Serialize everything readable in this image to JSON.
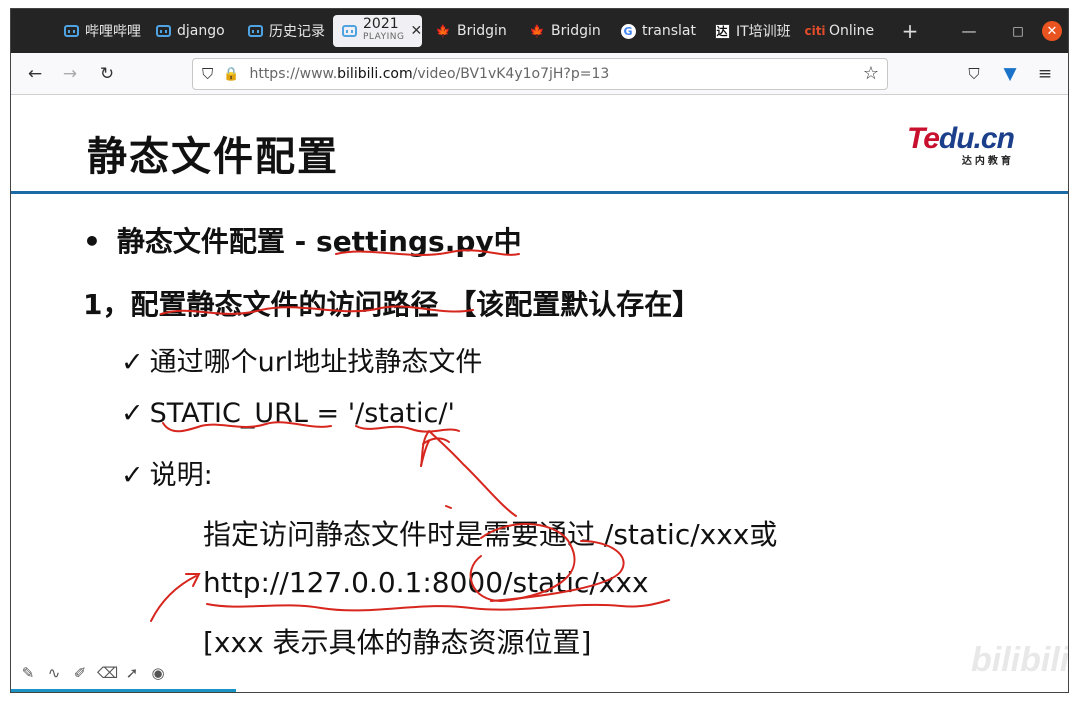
{
  "browser": {
    "tabs": [
      {
        "label": "哔哩哔哩",
        "icon": "bilibili-tv-icon"
      },
      {
        "label": "django",
        "icon": "bilibili-tv-icon"
      },
      {
        "label": "历史记录",
        "icon": "bilibili-tv-icon"
      },
      {
        "label": "2021",
        "sub": "PLAYING",
        "icon": "bilibili-tv-icon",
        "active": true
      },
      {
        "label": "Bridgin",
        "icon": "maple-leaf-icon"
      },
      {
        "label": "Bridgin",
        "icon": "maple-leaf-icon"
      },
      {
        "label": "translat",
        "icon": "google-icon"
      },
      {
        "label": "IT培训班",
        "icon": "tarena-icon"
      },
      {
        "label": "Online",
        "icon": "citi-icon"
      }
    ],
    "new_tab": "+",
    "url_prefix": "https://www.",
    "url_domain": "bilibili.com",
    "url_path": "/video/BV1vK4y1o7jH?p=13"
  },
  "slide": {
    "title": "静态文件配置",
    "logo_main_a": "Te",
    "logo_main_b": "du.cn",
    "logo_sub": "达内教育",
    "bullet1": "静态文件配置 - settings.py中",
    "line2": "1，配置静态文件的访问路径 【该配置默认存在】",
    "check1": "通过哪个url地址找静态文件",
    "check2": "STATIC_URL = '/static/'",
    "check3": "说明:",
    "desc1": "指定访问静态文件时是需要通过 /static/xxx或",
    "desc2": "http://127.0.0.1:8000/static/xxx",
    "desc3": "[xxx 表示具体的静态资源位置]",
    "watermark": "bilibili"
  },
  "colors": {
    "annotation": "#d7261e",
    "rule": "#1a6aa6",
    "progress": "#1a94c4"
  }
}
